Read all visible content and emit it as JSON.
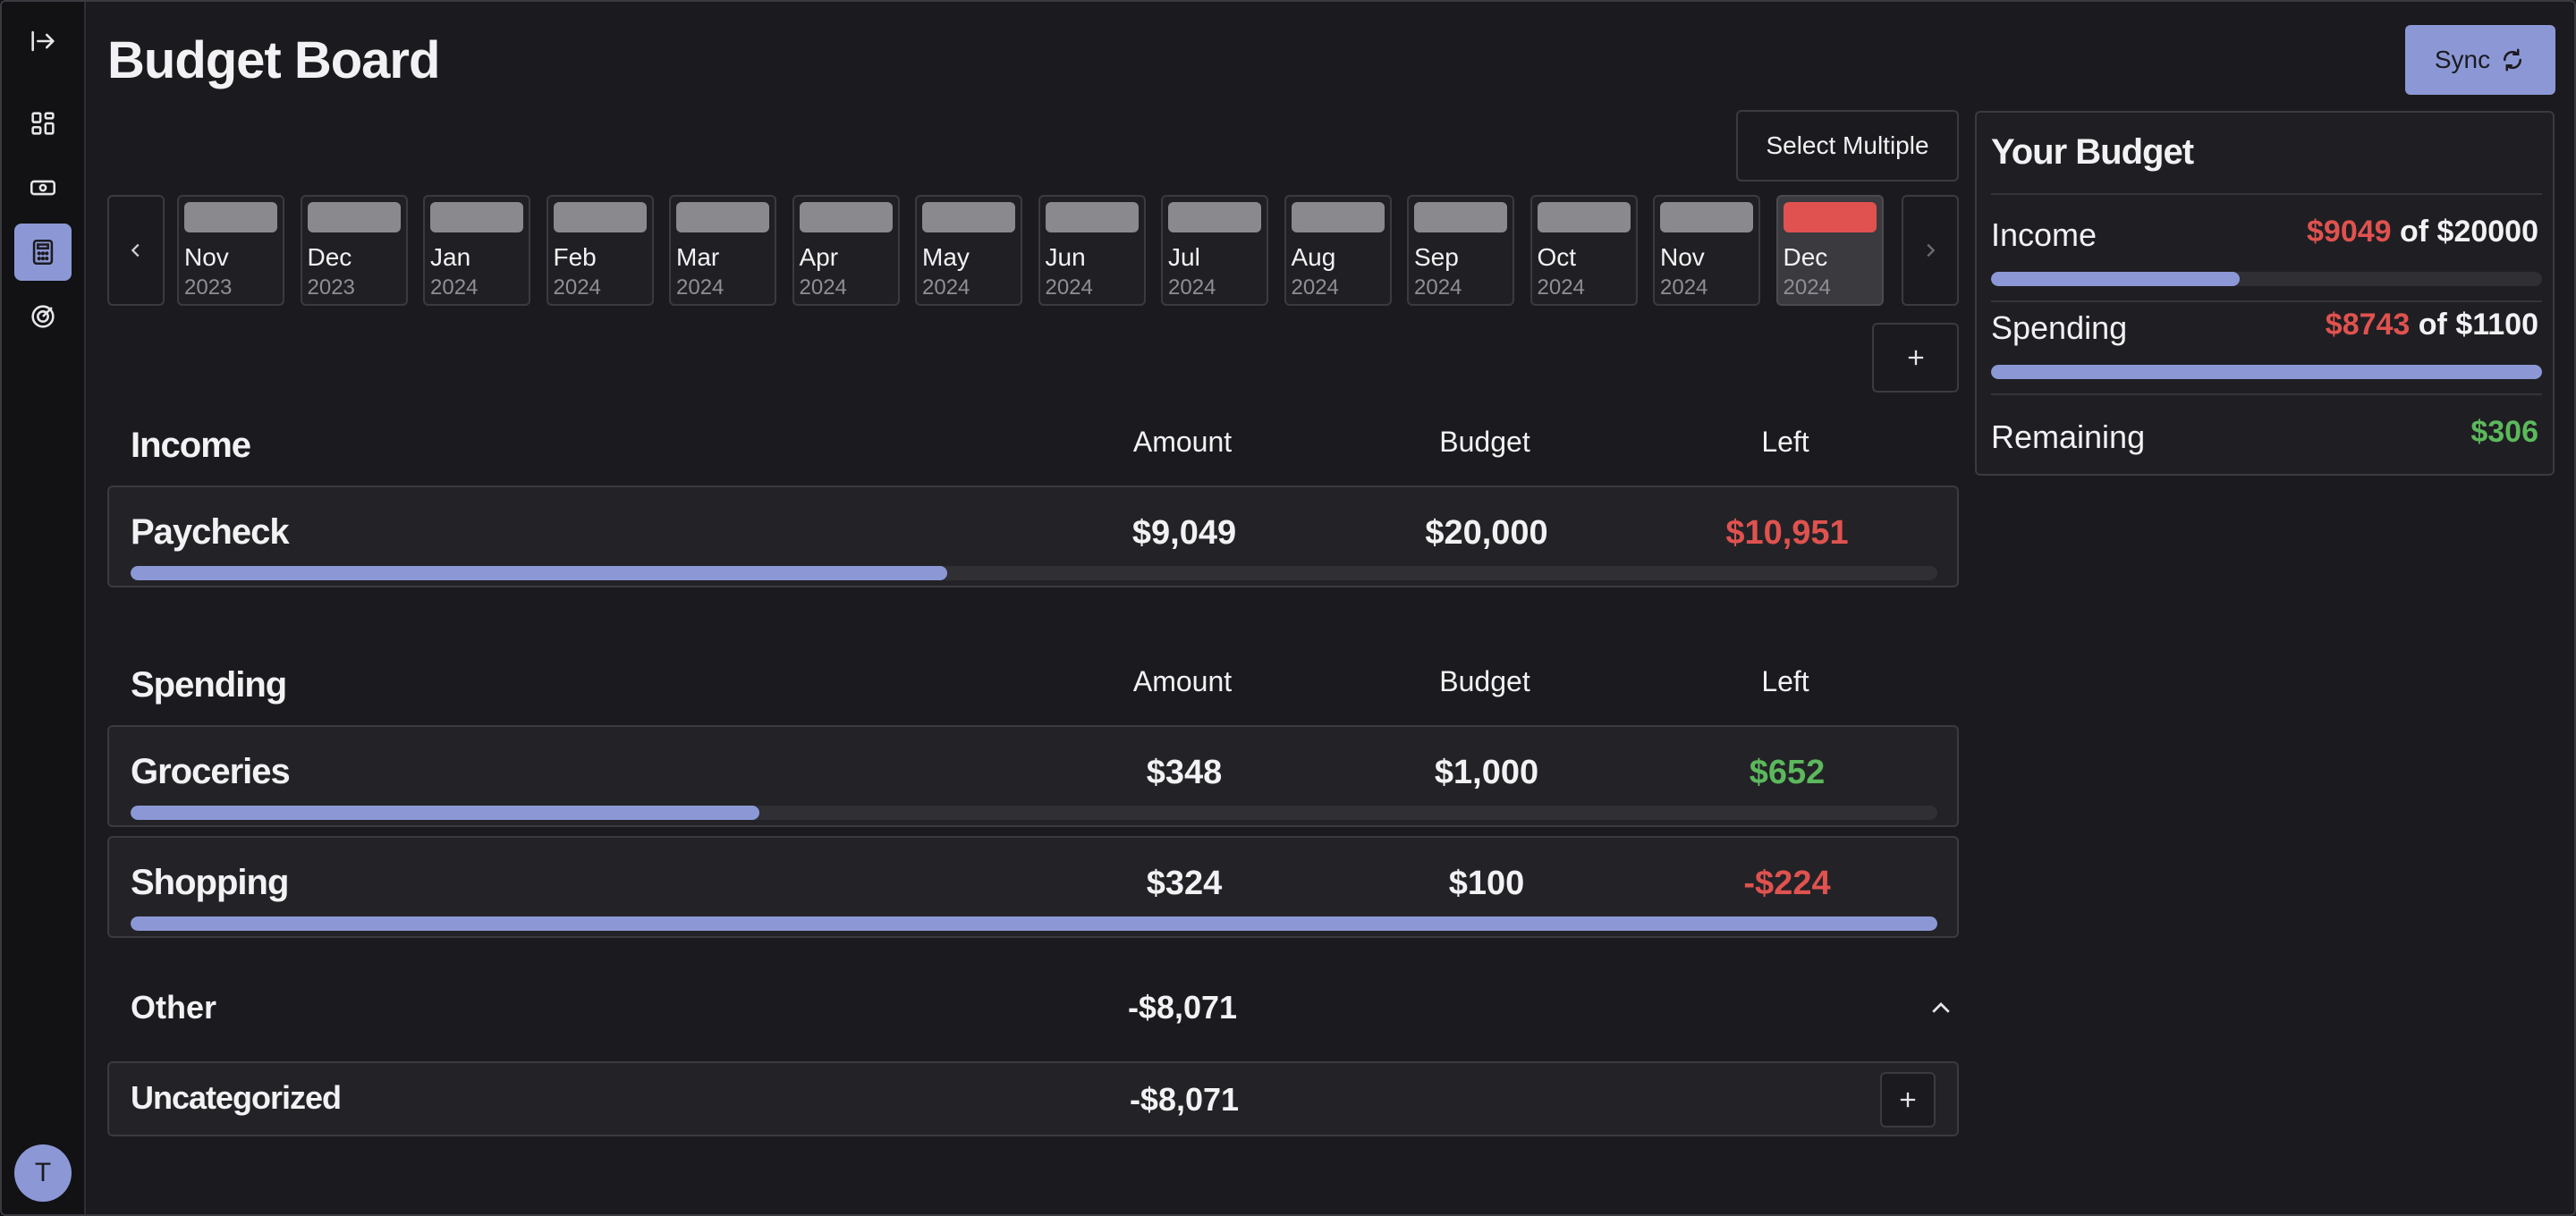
{
  "header": {
    "title": "Budget Board",
    "sync_label": "Sync"
  },
  "toolbar": {
    "select_multiple_label": "Select Multiple"
  },
  "sidebar": {
    "items": [
      {
        "icon": "collapse-sidebar-icon"
      },
      {
        "icon": "dashboard-icon"
      },
      {
        "icon": "money-icon"
      },
      {
        "icon": "calculator-icon",
        "active": true
      },
      {
        "icon": "goals-target-icon"
      }
    ],
    "avatar_initial": "T"
  },
  "months": [
    {
      "name": "Nov",
      "year": "2023"
    },
    {
      "name": "Dec",
      "year": "2023"
    },
    {
      "name": "Jan",
      "year": "2024"
    },
    {
      "name": "Feb",
      "year": "2024"
    },
    {
      "name": "Mar",
      "year": "2024"
    },
    {
      "name": "Apr",
      "year": "2024"
    },
    {
      "name": "May",
      "year": "2024"
    },
    {
      "name": "Jun",
      "year": "2024"
    },
    {
      "name": "Jul",
      "year": "2024"
    },
    {
      "name": "Aug",
      "year": "2024"
    },
    {
      "name": "Sep",
      "year": "2024"
    },
    {
      "name": "Oct",
      "year": "2024"
    },
    {
      "name": "Nov",
      "year": "2024"
    },
    {
      "name": "Dec",
      "year": "2024",
      "selected": true
    }
  ],
  "columns": {
    "amount": "Amount",
    "budget": "Budget",
    "left": "Left"
  },
  "income": {
    "title": "Income",
    "rows": [
      {
        "name": "Paycheck",
        "amount": "$9,049",
        "budget": "$20,000",
        "left": "$10,951",
        "left_status": "negative",
        "progress": 0.452
      }
    ]
  },
  "spending": {
    "title": "Spending",
    "rows": [
      {
        "name": "Groceries",
        "amount": "$348",
        "budget": "$1,000",
        "left": "$652",
        "left_status": "positive",
        "progress": 0.348
      },
      {
        "name": "Shopping",
        "amount": "$324",
        "budget": "$100",
        "left": "-$224",
        "left_status": "negative",
        "progress": 1.0
      }
    ]
  },
  "other": {
    "title": "Other",
    "total": "-$8,071",
    "rows": [
      {
        "name": "Uncategorized",
        "amount": "-$8,071"
      }
    ]
  },
  "summary": {
    "title": "Your Budget",
    "income": {
      "label": "Income",
      "value": "$9049",
      "of_text": " of $20000",
      "progress": 0.452
    },
    "spending": {
      "label": "Spending",
      "value": "$8743",
      "of_text": " of $1100",
      "progress": 1.0
    },
    "remaining": {
      "label": "Remaining",
      "value": "$306"
    }
  },
  "colors": {
    "accent": "#8c98d6",
    "negative": "#e0524f",
    "positive": "#5cb85c",
    "background": "#1b1b1f"
  }
}
